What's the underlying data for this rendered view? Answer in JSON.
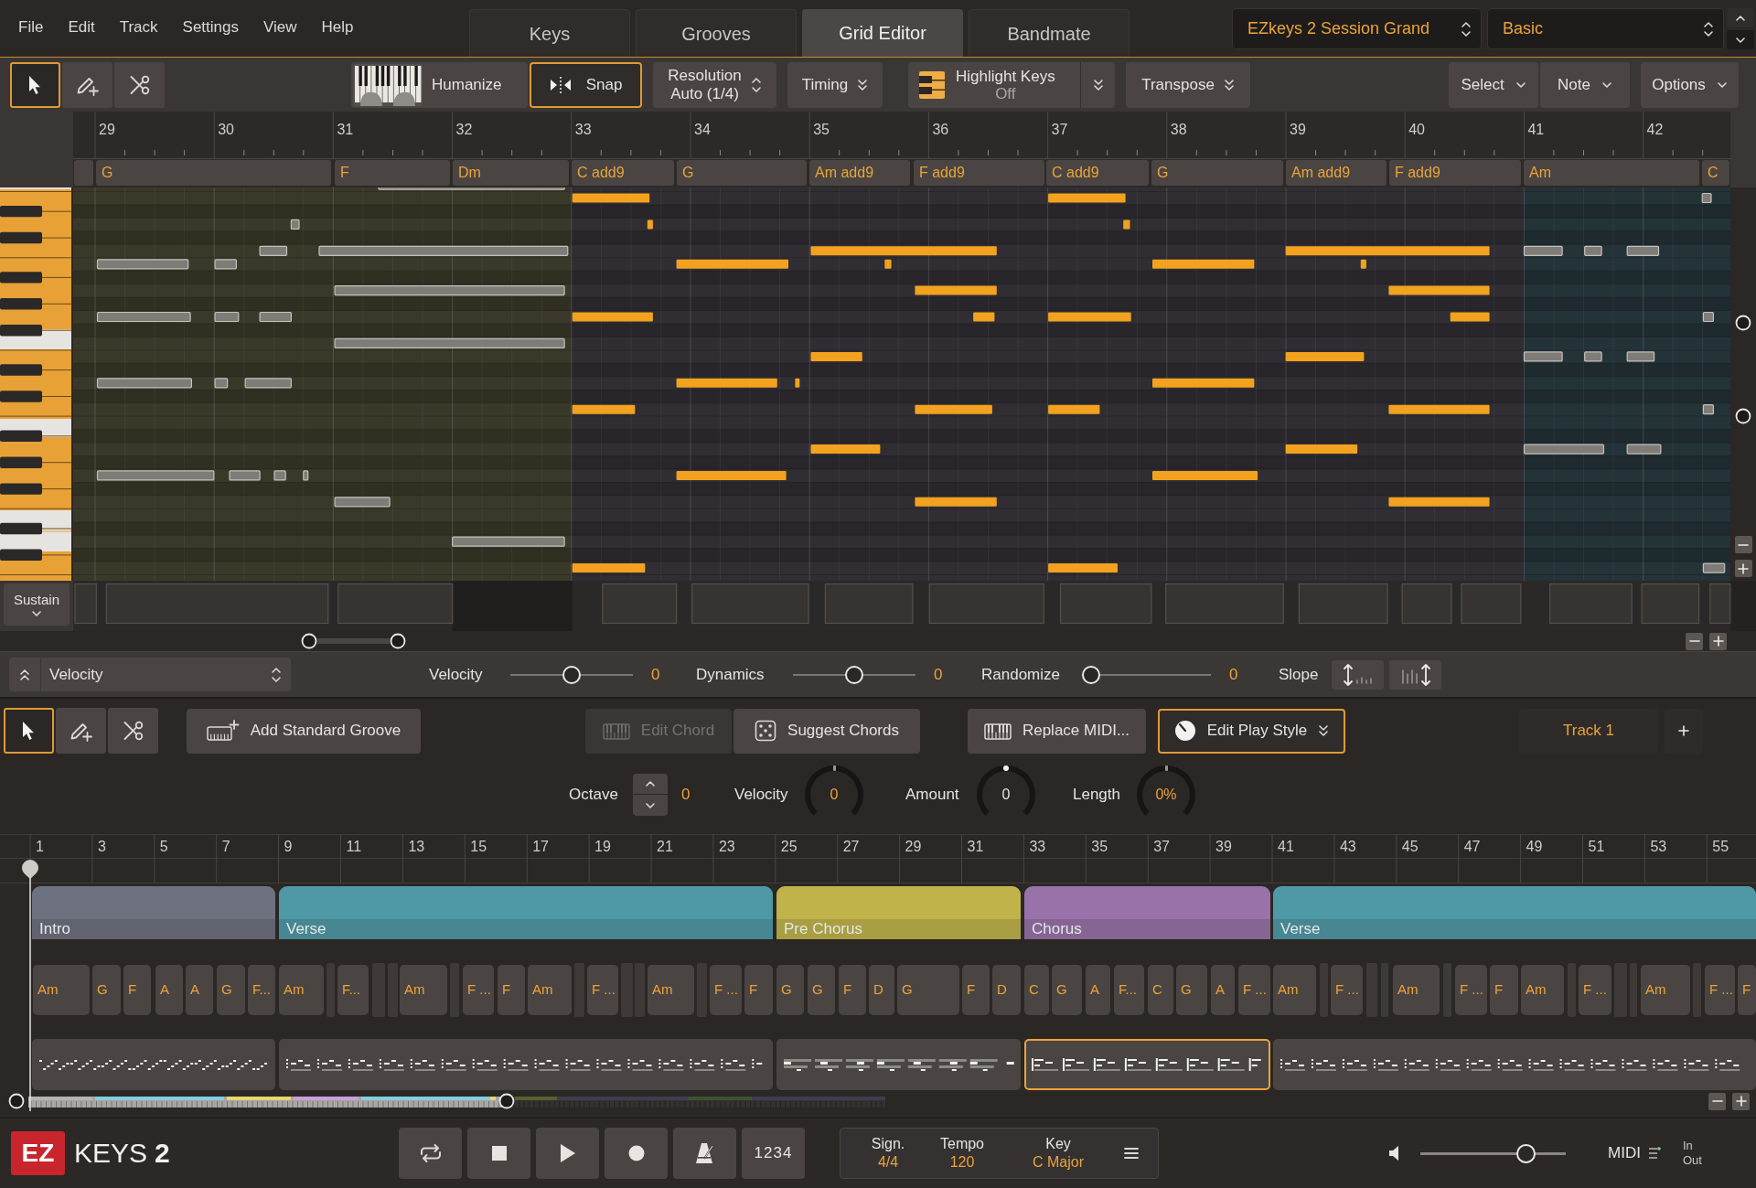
{
  "menu": [
    "File",
    "Edit",
    "Track",
    "Settings",
    "View",
    "Help"
  ],
  "tabs": [
    {
      "label": "Keys",
      "selected": false
    },
    {
      "label": "Grooves",
      "selected": false
    },
    {
      "label": "Grid Editor",
      "selected": true
    },
    {
      "label": "Bandmate",
      "selected": false
    }
  ],
  "presets": [
    "EZkeys 2 Session Grand",
    "Basic"
  ],
  "editor_toolbar": {
    "tools": [
      {
        "kind": "select",
        "selected": true
      },
      {
        "kind": "draw",
        "selected": false
      },
      {
        "kind": "cut",
        "selected": false
      }
    ],
    "humanize": "Humanize",
    "snap": {
      "label": "Snap",
      "on": true
    },
    "resolution": {
      "label": "Resolution",
      "value": "Auto (1/4)"
    },
    "timing": "Timing",
    "highlight_keys": {
      "label": "Highlight Keys",
      "value": "Off"
    },
    "transpose": "Transpose",
    "menus": [
      "Select",
      "Note",
      "Options"
    ]
  },
  "ruler": [
    "29",
    "30",
    "31",
    "32",
    "33",
    "34",
    "35",
    "36",
    "37",
    "38",
    "39",
    "40",
    "41",
    "42"
  ],
  "chord_track": [
    "G",
    "F",
    "Dm",
    "C add9",
    "G",
    "Am add9",
    "F add9",
    "C add9",
    "G",
    "Am add9",
    "F add9",
    "Am",
    "C"
  ],
  "sustain": "Sustain",
  "automation": {
    "lane": "Velocity",
    "sliders": [
      {
        "label": "Velocity",
        "level": 0.5,
        "reading": "0"
      },
      {
        "label": "Dynamics",
        "level": 0.5,
        "reading": "0"
      },
      {
        "label": "Randomize",
        "level": 0,
        "reading": "0"
      }
    ],
    "slope": "Slope"
  },
  "song_toolbar": {
    "tools": [
      {
        "kind": "select",
        "selected": true
      },
      {
        "kind": "draw",
        "selected": false
      },
      {
        "kind": "cut",
        "selected": false
      }
    ],
    "buttons": [
      {
        "kind": "groove",
        "label": "Add Standard Groove",
        "disabled": false,
        "active": false
      },
      {
        "kind": "chord",
        "label": "Edit Chord",
        "disabled": true,
        "active": false
      },
      {
        "kind": "dice",
        "label": "Suggest Chords",
        "disabled": false,
        "active": false
      },
      {
        "kind": "replace",
        "label": "Replace MIDI...",
        "disabled": false,
        "active": false
      },
      {
        "kind": "style",
        "label": "Edit Play Style",
        "disabled": false,
        "active": true
      }
    ],
    "track": "Track 1"
  },
  "play_controls": {
    "octave": {
      "label": "Octave",
      "value": "0"
    },
    "knobs": [
      {
        "label": "Velocity",
        "value": "0",
        "level": 0.5,
        "active": true
      },
      {
        "label": "Amount",
        "value": "0",
        "level": 0.5,
        "active": false
      },
      {
        "label": "Length",
        "value": "0%",
        "level": 0.5,
        "active": true
      }
    ]
  },
  "timeline": [
    "1",
    "3",
    "5",
    "7",
    "9",
    "11",
    "13",
    "15",
    "17",
    "19",
    "21",
    "23",
    "25",
    "27",
    "29",
    "31",
    "33",
    "35",
    "37",
    "39",
    "41",
    "43",
    "45",
    "47",
    "49",
    "51",
    "53",
    "55"
  ],
  "sections": [
    {
      "label": "Intro",
      "color": "#6e717f",
      "selected": false
    },
    {
      "label": "Verse",
      "color": "#4f99a6",
      "selected": false
    },
    {
      "label": "Pre Chorus",
      "color": "#c0b34a",
      "selected": false
    },
    {
      "label": "Chorus",
      "color": "#9872a8",
      "selected": true
    },
    {
      "label": "Verse",
      "color": "#4f99a6",
      "selected": false
    }
  ],
  "song_chords": [
    "Am",
    "G",
    "F",
    "A",
    "A",
    "G",
    "F...",
    "Am",
    "F...",
    "Am",
    "F ...",
    "F",
    "Am",
    "F ...",
    "Am",
    "F ...",
    "F",
    "G",
    "G",
    "F",
    "D",
    "G",
    "F",
    "D",
    "C",
    "G",
    "A",
    "F...",
    "C",
    "G",
    "A",
    "F ...",
    "Am",
    "F ...",
    "Am",
    "F ...",
    "F",
    "Am",
    "F ...",
    "Am",
    "F ...",
    "F"
  ],
  "logo": {
    "badge": "EZ",
    "name": "KEYS",
    "version": "2"
  },
  "transport": [
    {
      "kind": "loop"
    },
    {
      "kind": "stop"
    },
    {
      "kind": "play"
    },
    {
      "kind": "record"
    },
    {
      "kind": "metronome"
    },
    {
      "kind": "count_in",
      "label": "1234"
    }
  ],
  "song_info": [
    {
      "label": "Sign.",
      "value": "4/4"
    },
    {
      "label": "Tempo",
      "value": "120"
    },
    {
      "label": "Key",
      "value": "C Major"
    }
  ],
  "volume": {
    "level": 0.76
  },
  "midi": {
    "label": "MIDI",
    "input": "In",
    "output": "Out"
  }
}
